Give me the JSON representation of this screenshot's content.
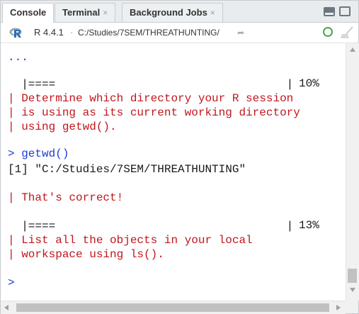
{
  "tabs": [
    {
      "label": "Console",
      "closable": false,
      "active": true
    },
    {
      "label": "Terminal",
      "closable": true,
      "active": false
    },
    {
      "label": "Background Jobs",
      "closable": true,
      "active": false
    }
  ],
  "tab_close_glyph": "×",
  "infobar": {
    "r_version": "R 4.4.1",
    "separator": "·",
    "working_dir": "C:/Studies/7SEM/THREATHUNTING/",
    "go_icon": "arrow-icon"
  },
  "console": {
    "lines": [
      {
        "text": "...",
        "color": "blue"
      },
      {
        "text": "  |====                                  |",
        "color": "black",
        "pct": "10%"
      },
      {
        "text": "| Determine which directory your R session",
        "color": "red"
      },
      {
        "text": "| is using as its current working directory",
        "color": "red"
      },
      {
        "text": "| using getwd().",
        "color": "red"
      },
      {
        "text": "",
        "color": "black"
      },
      {
        "text": "> getwd()",
        "color": "blue"
      },
      {
        "text": "[1] \"C:/Studies/7SEM/THREATHUNTING\"",
        "color": "black"
      },
      {
        "text": "",
        "color": "black"
      },
      {
        "text": "| That's correct!",
        "color": "red"
      },
      {
        "text": "",
        "color": "black"
      },
      {
        "text": "  |====                                  |",
        "color": "black",
        "pct": "13%"
      },
      {
        "text": "| List all the objects in your local",
        "color": "red"
      },
      {
        "text": "| workspace using ls().",
        "color": "red"
      },
      {
        "text": "",
        "color": "black"
      },
      {
        "text": ">",
        "color": "blue"
      }
    ]
  },
  "colors": {
    "prompt": "#1b3cd6",
    "message": "#c0161c",
    "output": "#1a1a1a"
  }
}
